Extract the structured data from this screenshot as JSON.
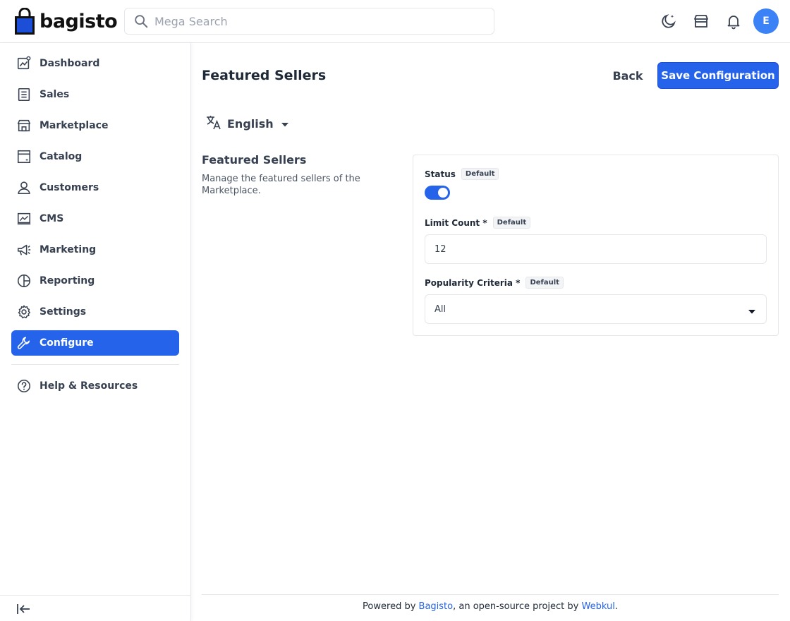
{
  "app": {
    "logo_text": "bagisto"
  },
  "search": {
    "placeholder": "Mega Search"
  },
  "header": {
    "avatar_letter": "E"
  },
  "sidebar": {
    "items": [
      {
        "label": "Dashboard",
        "icon": "dashboard-icon"
      },
      {
        "label": "Sales",
        "icon": "sales-icon"
      },
      {
        "label": "Marketplace",
        "icon": "store-icon"
      },
      {
        "label": "Catalog",
        "icon": "catalog-icon"
      },
      {
        "label": "Customers",
        "icon": "person-icon"
      },
      {
        "label": "CMS",
        "icon": "cms-icon"
      },
      {
        "label": "Marketing",
        "icon": "megaphone-icon"
      },
      {
        "label": "Reporting",
        "icon": "pie-chart-icon"
      },
      {
        "label": "Settings",
        "icon": "gear-icon"
      },
      {
        "label": "Configure",
        "icon": "wrench-icon",
        "active": true
      },
      {
        "label": "Help & Resources",
        "icon": "help-icon"
      }
    ]
  },
  "page": {
    "title": "Featured Sellers",
    "back_label": "Back",
    "save_label": "Save Configuration",
    "locale": "English"
  },
  "section": {
    "title": "Featured Sellers",
    "description": "Manage the featured sellers of the Marketplace."
  },
  "form": {
    "status_label": "Status",
    "status_on": true,
    "limit_label": "Limit Count *",
    "limit_value": "12",
    "criteria_label": "Popularity Criteria *",
    "criteria_value": "All",
    "default_badge": "Default"
  },
  "footer": {
    "prefix": "Powered by ",
    "link1": "Bagisto",
    "middle": ", an open-source project by ",
    "link2": "Webkul",
    "suffix": "."
  },
  "colors": {
    "accent": "#2563eb",
    "avatar": "#3b82f6"
  }
}
